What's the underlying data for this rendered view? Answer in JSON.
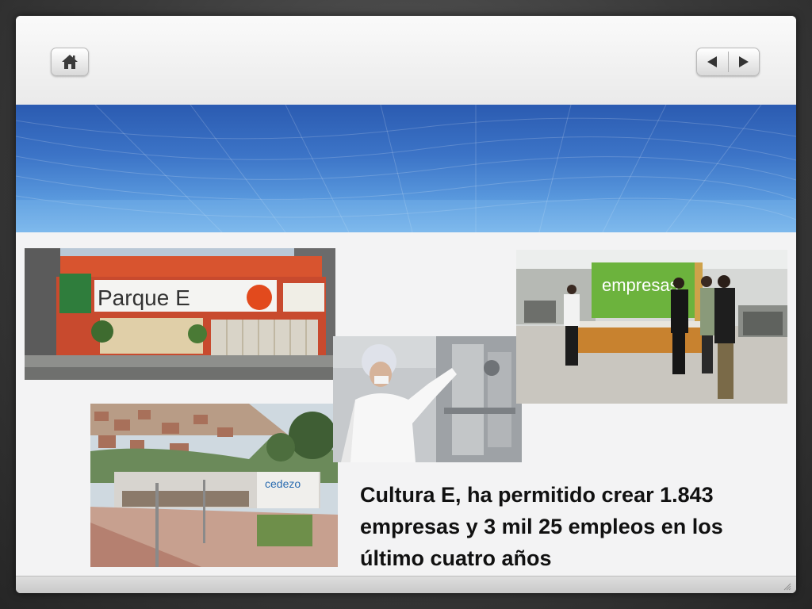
{
  "toolbar": {
    "home_icon": "home-icon",
    "prev_icon": "triangle-left-icon",
    "next_icon": "triangle-right-icon"
  },
  "photos": {
    "parque_sign": "Parque E",
    "cedezo_sign": "cedezo",
    "empresas_banner": "empresas"
  },
  "caption": {
    "text": "Cultura E, ha permitido crear  1.843 empresas y 3 mil 25 empleos en los último cuatro años"
  },
  "colors": {
    "banner_blue": "#3c74c7",
    "slide_bg": "#f4f4f5"
  }
}
